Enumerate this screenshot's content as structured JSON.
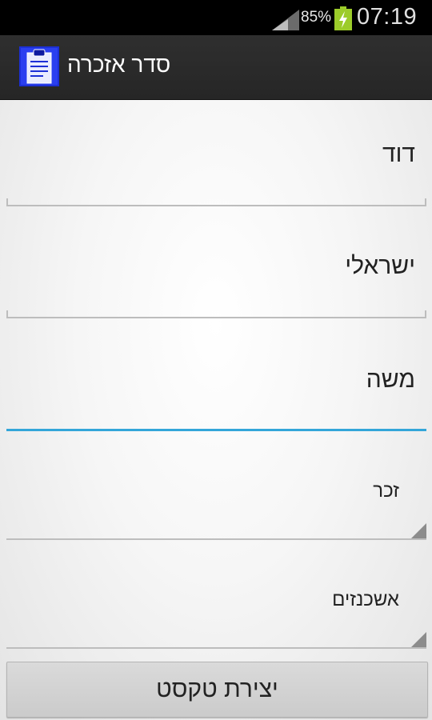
{
  "status_bar": {
    "battery_percent": "85%",
    "time": "07:19",
    "icons": [
      "signal-icon",
      "battery-charging-icon"
    ]
  },
  "action_bar": {
    "title": "סדר אזכרה",
    "icon": "clipboard-icon"
  },
  "form": {
    "first_name_value": "דוד",
    "last_name_value": "ישראלי",
    "father_name_value": "משה",
    "gender_selected": "זכר",
    "community_selected": "אשכנזים",
    "submit_label": "יצירת טקסט"
  },
  "colors": {
    "focus_accent": "#33a6d9",
    "action_bar": "#2b2b2b",
    "button": "#d3d3d3"
  }
}
